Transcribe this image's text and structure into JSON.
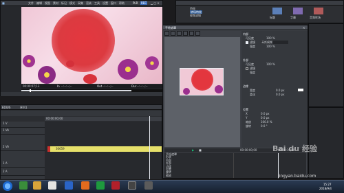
{
  "colors": {
    "accent_green": "#18c47a",
    "clip_yellow": "#e6e06a",
    "clip_red": "#c9302c",
    "timeline_cursor": "#e8ecf2",
    "taskbar_bg": "#1e2b3e"
  },
  "player": {
    "menu": [
      "文件",
      "编辑",
      "视图",
      "素材",
      "标记",
      "模式",
      "采集",
      "渲染",
      "工具",
      "设置",
      "窗口",
      "帮助"
    ],
    "mode_label": "PLR",
    "rec_label": "REC",
    "timecode_in_label": "In",
    "timecode_out_label": "Out",
    "timecode_dur_label": "Dur",
    "timecode_cur": "00:00:07;13",
    "timecode_in": "--:--:--;--",
    "timecode_out": "--:--:--;--",
    "timecode_dur": "--:--:--;--"
  },
  "bin": {
    "items": [
      "特效",
      "转场特效",
      "视频滤镜"
    ],
    "thumb_labels": [
      "标题",
      "字幕",
      "音频转场"
    ]
  },
  "effect_dialog": {
    "title": "手绘遮罩",
    "sections": {
      "inside": "内部",
      "outside": "外部",
      "border": "边缘",
      "position": "位置"
    },
    "fields": {
      "opacity_label": "可见度",
      "opacity_value": "100 %",
      "filter_label": "滤镜",
      "filter_value": "高斯模糊",
      "strength_label": "强度",
      "strength_value": "100 %",
      "feather_label": "柔化",
      "width_label": "宽度",
      "width_value": "0.0 px",
      "x_label": "X",
      "y_label": "Y",
      "x_value": "0.0 px",
      "y_value": "0.0 px",
      "rotate_label": "旋转",
      "rotate_value": "0.0 °",
      "scale_label": "缩放",
      "scale_value": "100.0 %"
    },
    "timeline_timecodes": [
      "00:00:00;00",
      "00:00:07;13",
      "00:00:10;00"
    ],
    "layers": [
      "手绘遮罩",
      "形状",
      "内部",
      "外部",
      "边缘",
      "位置",
      "旋转",
      "缩放"
    ],
    "ok_label": "确定",
    "cancel_label": "取消"
  },
  "timeline": {
    "title": "EDIUS",
    "sequence_tab": "序列1",
    "track_labels": [
      "1 V",
      "1 VA",
      "2 VA",
      "1 A",
      "2 A"
    ],
    "clip_label": "30659",
    "ruler_start": "00:00:00;00"
  },
  "taskbar": {
    "clock_time": "15:27",
    "clock_date": "2018/9/4"
  },
  "watermark": {
    "text": "Bai du 经验",
    "url": "jingyan.baidu.com"
  }
}
